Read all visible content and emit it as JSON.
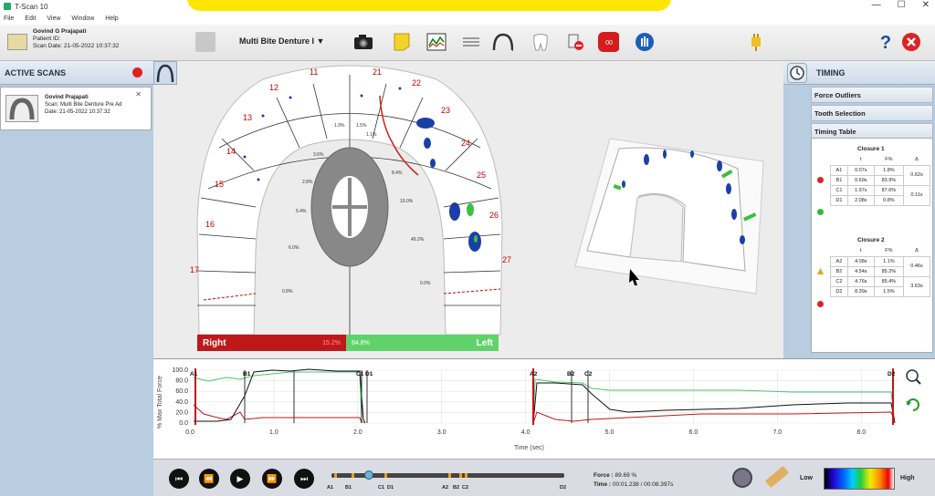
{
  "window": {
    "title": "T-Scan 10",
    "controls": {
      "minimize": "—",
      "maximize": "☐",
      "close": "✕"
    }
  },
  "menu": [
    "File",
    "Edit",
    "View",
    "Window",
    "Help"
  ],
  "patient": {
    "name": "Govind G Prajapati",
    "id_label": "Patient ID:",
    "scan_date_label": "Scan Date:",
    "scan_date": "21-05-2022 10:37:32"
  },
  "toolbar": {
    "scan_select": "Multi Bite Denture I",
    "icons": [
      "camera-icon",
      "note-icon",
      "graph-icon",
      "layers-icon",
      "arch-icon",
      "tooth-icon",
      "eraser-icon",
      "record-icon",
      "hand-icon",
      "plug-icon",
      "help-icon",
      "close-icon"
    ]
  },
  "active_scans": {
    "header": "ACTIVE SCANS",
    "card": {
      "name": "Govind Prajapati",
      "scan_label": "Scan:",
      "scan_value": "Multi Bite Denture Pre Ad",
      "date_label": "Date:",
      "date_value": "21-05-2022 10:37:32"
    }
  },
  "arch_view": {
    "tooth_numbers": [
      {
        "label": "11"
      },
      {
        "label": "12"
      },
      {
        "label": "13"
      },
      {
        "label": "14"
      },
      {
        "label": "15"
      },
      {
        "label": "16"
      },
      {
        "label": "17"
      },
      {
        "label": "21"
      },
      {
        "label": "22"
      },
      {
        "label": "23"
      },
      {
        "label": "24"
      },
      {
        "label": "25"
      },
      {
        "label": "26"
      },
      {
        "label": "27"
      }
    ],
    "percents": [
      "1.9%",
      "1.5%",
      "3.6%",
      "1.1%",
      "8.4%",
      "2.8%",
      "10.0%",
      "5.4%",
      "49.2%",
      "6.0%",
      "0.0%",
      "0.8%"
    ],
    "right_label": "Right",
    "right_value": "15.2%",
    "left_label": "Left",
    "left_value": "84.8%"
  },
  "timing_panel": {
    "header": "TIMING",
    "sections": [
      "Force Outliers",
      "Tooth Selection",
      "Timing Table"
    ],
    "closures": [
      {
        "title": "Closure 1",
        "cols": [
          "",
          "t",
          "F%",
          "Δ"
        ],
        "rows": [
          {
            "k": "A1",
            "t": "0.07s",
            "f": "1.8%",
            "d": "0.62s"
          },
          {
            "k": "B1",
            "t": "0.69s",
            "f": "83.9%",
            "d": ""
          },
          {
            "k": "C1",
            "t": "1.97s",
            "f": "87.6%",
            "d": "0.11s"
          },
          {
            "k": "D1",
            "t": "2.08s",
            "f": "0.8%",
            "d": ""
          }
        ]
      },
      {
        "title": "Closure 2",
        "cols": [
          "",
          "t",
          "F%",
          "Δ"
        ],
        "rows": [
          {
            "k": "A2",
            "t": "4.08s",
            "f": "1.1%",
            "d": "0.46s"
          },
          {
            "k": "B2",
            "t": "4.54s",
            "f": "85.2%",
            "d": ""
          },
          {
            "k": "C2",
            "t": "4.76s",
            "f": "85.4%",
            "d": "3.63s"
          },
          {
            "k": "D2",
            "t": "8.39s",
            "f": "1.5%",
            "d": ""
          }
        ]
      }
    ]
  },
  "graph": {
    "y_title": "% Max Total Force",
    "x_title": "Time (sec)",
    "y_ticks": [
      "100.0",
      "80.0",
      "60.0",
      "40.0",
      "20.0",
      "0.0"
    ],
    "x_ticks": [
      "0.0",
      "1.0",
      "2.0",
      "3.0",
      "4.0",
      "5.0",
      "6.0",
      "7.0",
      "8.0"
    ],
    "markers": [
      "A1",
      "B1",
      "C1",
      "D1",
      "A2",
      "B2",
      "C2",
      "D2"
    ]
  },
  "playback": {
    "buttons": [
      "⏮",
      "⏪",
      "▶",
      "⏩",
      "⏭"
    ],
    "track_labels": [
      "A1",
      "B1",
      "C1",
      "D1",
      "A2",
      "B2",
      "C2",
      "D2"
    ],
    "force_label": "Force :",
    "force_value": "89.69 %",
    "time_label": "Time :",
    "time_value": "00:01.238 / 00:08.397s",
    "legend_low": "Low",
    "legend_high": "High"
  }
}
